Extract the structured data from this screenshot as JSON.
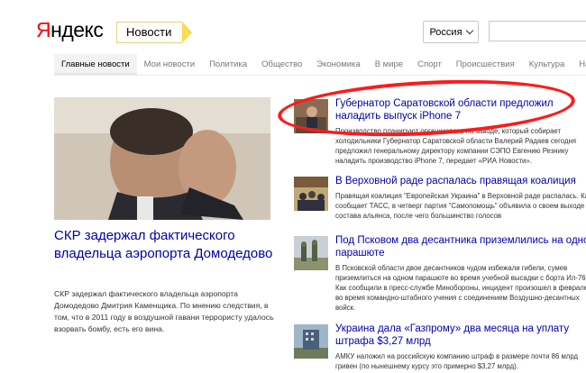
{
  "header": {
    "logo_first": "Я",
    "logo_rest": "ндекс",
    "section": "Новости",
    "region": "Россия"
  },
  "tabs": [
    "Главные новости",
    "Мои новости",
    "Политика",
    "Общество",
    "Экономика",
    "В мире",
    "Спорт",
    "Происшествия",
    "Культура",
    "Наука"
  ],
  "main_story": {
    "title": "СКР задержал фактического владельца аэропорта Домодедово",
    "text": "СКР задержал фактического владельца аэропорта Домодедово Дмитрия Каменщика. По мнению следствия, в том, что в 2011 году в воздушной гавани террористу удалось взорвать бомбу, есть его вина."
  },
  "news": [
    {
      "title": "Губернатор Саратовской области предложил наладить выпуск iPhone 7",
      "text": "Производство планируют организовать на заводе, который собирает холодильники Губернатор Саратовской области Валерий Радаев сегодня предложил генеральному директору компании СЭПО Евгению Резнику наладить производство iPhone 7, передает «РИА Новости»."
    },
    {
      "title": "В Верховной раде распалась правящая коалиция",
      "text": "Правящая коалиция \"Европейская Украина\" в Верховной раде распалась. Как сообщает ТАСС, в четверг партия \"Самопомощь\" объявила о своем выходе из состава альянса, после чего большинство голосов"
    },
    {
      "title": "Под Псковом два десантника приземлились на одном парашюте",
      "text": "В Псковской области двое десантников чудом избежали гибели, сумев приземлиться на одном парашюте во время учебной высадки с борта Ил-76. Как сообщили в пресс-службе Минобороны, инцидент произошел в феврале во время командно-штабного учения с соединением Воздушно-десантных войск."
    },
    {
      "title": "Украина дала «Газпрому» два месяца на уплату штрафа $3,27 млрд",
      "text": "АМКУ наложил на российскую компанию штраф в размере почти 86 млрд гривен (по нынешнему курсу это примерно $3,27 млрд)."
    }
  ],
  "colors": {
    "accent": "#ff0000",
    "link": "#0000aa",
    "annotation": "#ff1a1a",
    "tag_arrow": "#ffdb4d"
  }
}
